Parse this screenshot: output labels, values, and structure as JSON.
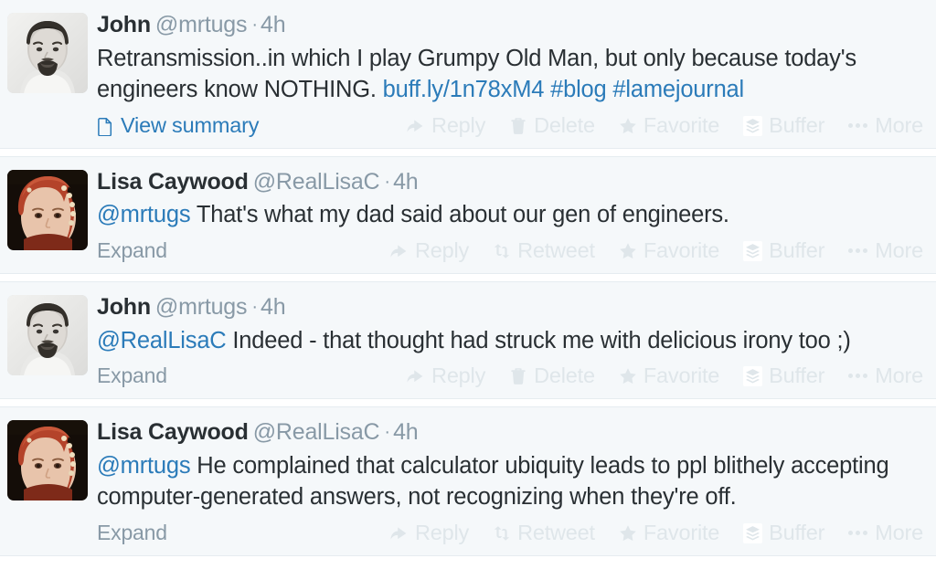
{
  "thread": {
    "tweets": [
      {
        "id": "tweet-1",
        "author": {
          "fullname": "John",
          "username": "@mrtugs",
          "avatar_type": "photo-man-bw"
        },
        "timestamp": "4h",
        "separator": "·",
        "text_segments": [
          {
            "type": "text",
            "value": "Retransmission..in which I play Grumpy Old Man, but only because today's engineers know NOTHING. "
          },
          {
            "type": "link",
            "value": "buff.ly/1n78xM4"
          },
          {
            "type": "text",
            "value": " "
          },
          {
            "type": "hashtag",
            "value": "#blog"
          },
          {
            "type": "text",
            "value": " "
          },
          {
            "type": "hashtag",
            "value": "#lamejournal"
          }
        ],
        "footer_link": {
          "label": "View summary",
          "icon": "document-icon",
          "style": "summary"
        },
        "actions": [
          {
            "label": "Reply",
            "icon": "reply-arrow-icon"
          },
          {
            "label": "Delete",
            "icon": "trash-icon"
          },
          {
            "label": "Favorite",
            "icon": "star-icon"
          },
          {
            "label": "Buffer",
            "icon": "buffer-stack-icon"
          },
          {
            "label": "More",
            "icon": "ellipsis-icon"
          }
        ]
      },
      {
        "id": "tweet-2",
        "author": {
          "fullname": "Lisa Caywood",
          "username": "@RealLisaC",
          "avatar_type": "painting-woman-red"
        },
        "timestamp": "4h",
        "separator": "·",
        "text_segments": [
          {
            "type": "mention",
            "value": "@mrtugs"
          },
          {
            "type": "text",
            "value": " That's what my dad said about our gen of engineers."
          }
        ],
        "footer_link": {
          "label": "Expand",
          "icon": "",
          "style": "expand"
        },
        "actions": [
          {
            "label": "Reply",
            "icon": "reply-arrow-icon"
          },
          {
            "label": "Retweet",
            "icon": "retweet-icon"
          },
          {
            "label": "Favorite",
            "icon": "star-icon"
          },
          {
            "label": "Buffer",
            "icon": "buffer-stack-icon"
          },
          {
            "label": "More",
            "icon": "ellipsis-icon"
          }
        ]
      },
      {
        "id": "tweet-3",
        "author": {
          "fullname": "John",
          "username": "@mrtugs",
          "avatar_type": "photo-man-bw"
        },
        "timestamp": "4h",
        "separator": "·",
        "text_segments": [
          {
            "type": "mention",
            "value": "@RealLisaC"
          },
          {
            "type": "text",
            "value": " Indeed - that thought had struck me with delicious irony too ;)"
          }
        ],
        "footer_link": {
          "label": "Expand",
          "icon": "",
          "style": "expand"
        },
        "actions": [
          {
            "label": "Reply",
            "icon": "reply-arrow-icon"
          },
          {
            "label": "Delete",
            "icon": "trash-icon"
          },
          {
            "label": "Favorite",
            "icon": "star-icon"
          },
          {
            "label": "Buffer",
            "icon": "buffer-stack-icon"
          },
          {
            "label": "More",
            "icon": "ellipsis-icon"
          }
        ]
      },
      {
        "id": "tweet-4",
        "author": {
          "fullname": "Lisa Caywood",
          "username": "@RealLisaC",
          "avatar_type": "painting-woman-red"
        },
        "timestamp": "4h",
        "separator": "·",
        "text_segments": [
          {
            "type": "mention",
            "value": "@mrtugs"
          },
          {
            "type": "text",
            "value": " He complained that calculator ubiquity leads to ppl blithely accepting computer-generated answers, not recognizing when they're off."
          }
        ],
        "footer_link": {
          "label": "Expand",
          "icon": "",
          "style": "expand"
        },
        "actions": [
          {
            "label": "Reply",
            "icon": "reply-arrow-icon"
          },
          {
            "label": "Retweet",
            "icon": "retweet-icon"
          },
          {
            "label": "Favorite",
            "icon": "star-icon"
          },
          {
            "label": "Buffer",
            "icon": "buffer-stack-icon"
          },
          {
            "label": "More",
            "icon": "ellipsis-icon"
          }
        ]
      }
    ]
  },
  "colors": {
    "tweet_background": "#f5f8fa",
    "page_background": "#ffffff",
    "link": "#2b7bb9",
    "text": "#292f33",
    "muted": "#8899a6",
    "action_muted": "#dfe6ea",
    "border": "#e6ecf0"
  }
}
